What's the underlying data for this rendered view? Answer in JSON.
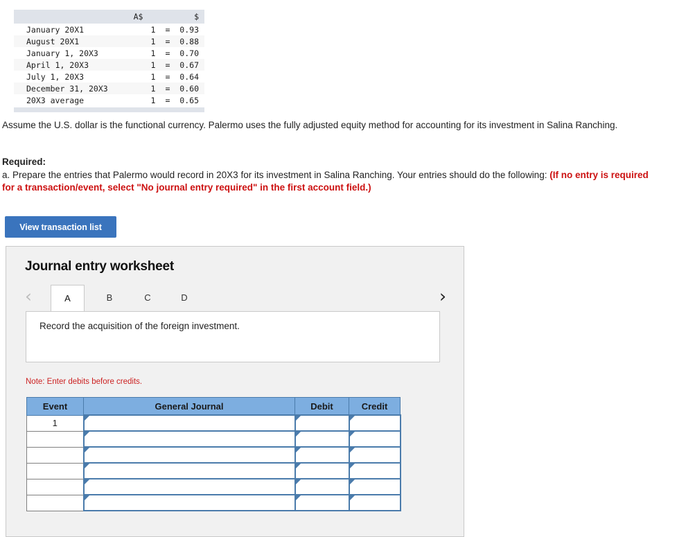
{
  "fx_table": {
    "headers": [
      "",
      "A$",
      "$"
    ],
    "rows": [
      {
        "label": "January 20X1",
        "a": "1",
        "eq": "=",
        "usd": "0.93"
      },
      {
        "label": "August 20X1",
        "a": "1",
        "eq": "=",
        "usd": "0.88"
      },
      {
        "label": "January 1, 20X3",
        "a": "1",
        "eq": "=",
        "usd": "0.70"
      },
      {
        "label": "April 1, 20X3",
        "a": "1",
        "eq": "=",
        "usd": "0.67"
      },
      {
        "label": "July 1, 20X3",
        "a": "1",
        "eq": "=",
        "usd": "0.64"
      },
      {
        "label": "December 31, 20X3",
        "a": "1",
        "eq": "=",
        "usd": "0.60"
      },
      {
        "label": "20X3 average",
        "a": "1",
        "eq": "=",
        "usd": "0.65"
      }
    ]
  },
  "narrative": {
    "assume": "Assume the U.S. dollar is the functional currency. Palermo uses the fully adjusted equity method for accounting for its investment in Salina Ranching.",
    "required_label": "Required:",
    "required_black": "a. Prepare the entries that Palermo would record in 20X3 for its investment in Salina Ranching. Your entries should do the following: ",
    "required_red": "(If no entry is required for a transaction/event, select \"No journal entry required\" in the first account field.)"
  },
  "buttons": {
    "view_transaction_list": "View transaction list"
  },
  "worksheet": {
    "title": "Journal entry worksheet",
    "prev_icon": "chevron-left",
    "next_icon": "chevron-right",
    "prev_glyph": "‹",
    "next_glyph": "›",
    "tabs": [
      {
        "label": "A",
        "active": true
      },
      {
        "label": "B",
        "active": false
      },
      {
        "label": "C",
        "active": false
      },
      {
        "label": "D",
        "active": false
      }
    ],
    "prompt": "Record the acquisition of the foreign investment.",
    "note": "Note: Enter debits before credits.",
    "journal": {
      "headers": [
        "Event",
        "General Journal",
        "Debit",
        "Credit"
      ],
      "rows": [
        {
          "event": "1",
          "general_journal": "",
          "debit": "",
          "credit": ""
        },
        {
          "event": "",
          "general_journal": "",
          "debit": "",
          "credit": ""
        },
        {
          "event": "",
          "general_journal": "",
          "debit": "",
          "credit": ""
        },
        {
          "event": "",
          "general_journal": "",
          "debit": "",
          "credit": ""
        },
        {
          "event": "",
          "general_journal": "",
          "debit": "",
          "credit": ""
        },
        {
          "event": "",
          "general_journal": "",
          "debit": "",
          "credit": ""
        }
      ]
    }
  },
  "colors": {
    "button_blue": "#3a74bd",
    "table_header_blue": "#7daee0",
    "cell_border_blue": "#4a7bab",
    "panel_gray": "#f1f1f1",
    "alert_red": "#cc1111",
    "fx_header_gray": "#dfe3ea"
  }
}
